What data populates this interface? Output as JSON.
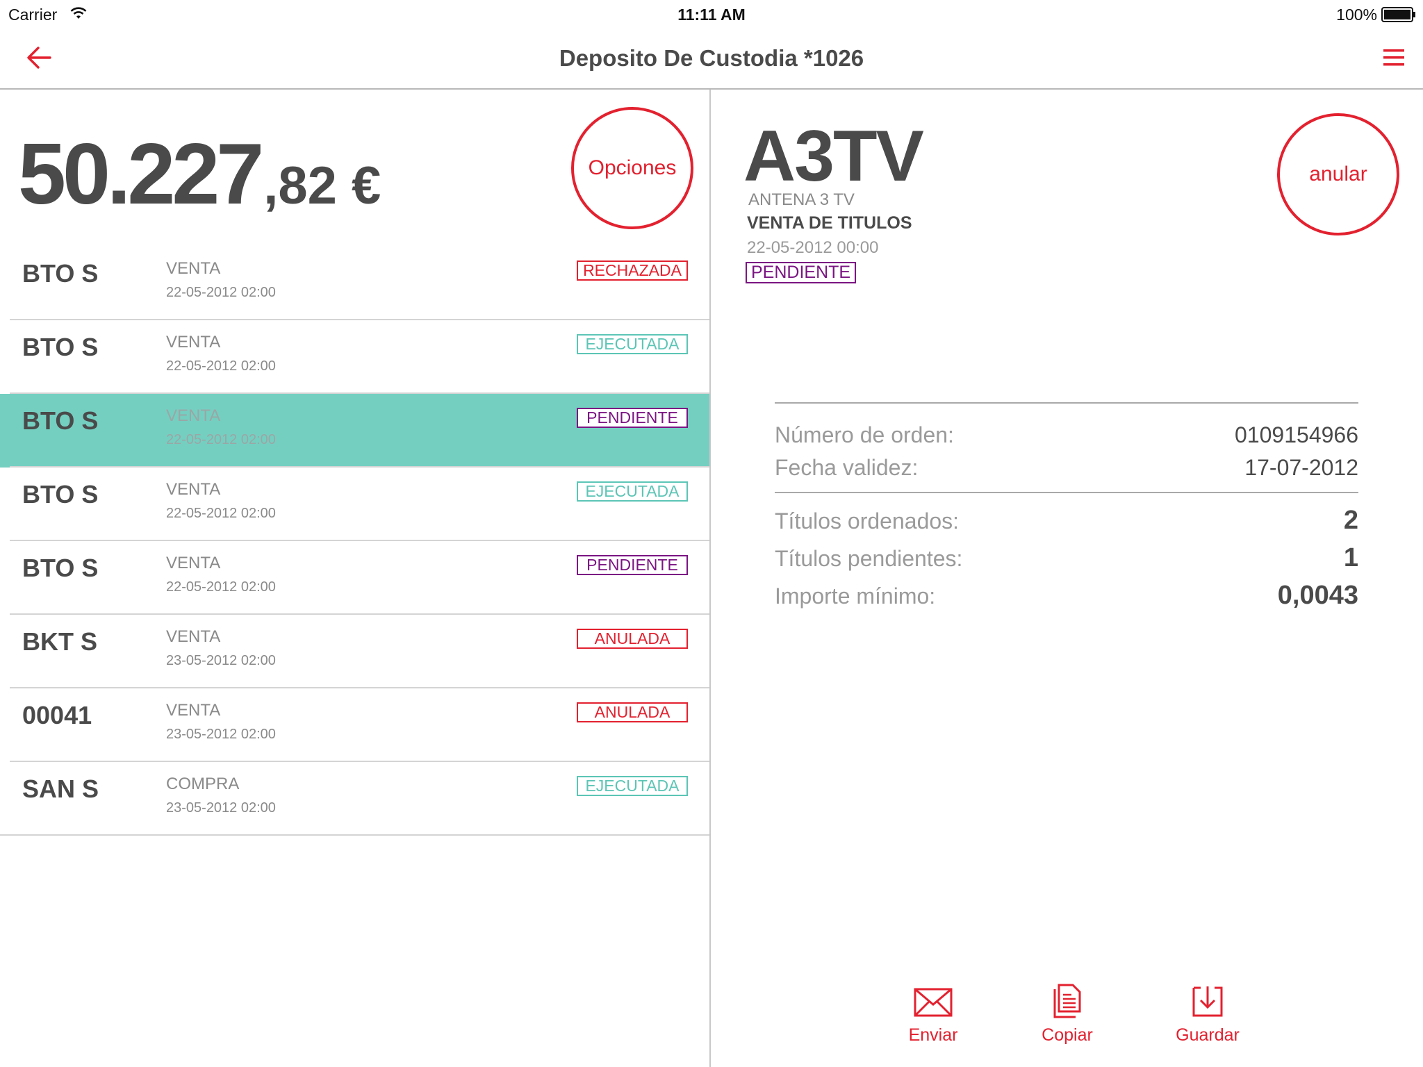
{
  "status_bar": {
    "carrier": "Carrier",
    "time": "11:11 AM",
    "battery": "100%"
  },
  "navbar": {
    "title": "Deposito De Custodia *1026",
    "back_icon": "arrow-left-icon",
    "menu_icon": "hamburger-menu-icon",
    "accent_color": "#e3212f"
  },
  "balance": {
    "integer_part": "50.227",
    "decimal_part": ",82 €"
  },
  "options_button": {
    "label": "Opciones"
  },
  "orders": [
    {
      "symbol": "BTO S",
      "operation": "VENTA",
      "date": "22-05-2012 02:00",
      "status": "RECHAZADA",
      "status_color": "#e3212f"
    },
    {
      "symbol": "BTO S",
      "operation": "VENTA",
      "date": "22-05-2012 02:00",
      "status": "EJECUTADA",
      "status_color": "#5cc5b6"
    },
    {
      "symbol": "BTO S",
      "operation": "VENTA",
      "date": "22-05-2012 02:00",
      "status": "PENDIENTE",
      "status_color": "#7b1583",
      "selected": true
    },
    {
      "symbol": "BTO S",
      "operation": "VENTA",
      "date": "22-05-2012 02:00",
      "status": "EJECUTADA",
      "status_color": "#5cc5b6"
    },
    {
      "symbol": "BTO S",
      "operation": "VENTA",
      "date": "22-05-2012 02:00",
      "status": "PENDIENTE",
      "status_color": "#7b1583"
    },
    {
      "symbol": "BKT S",
      "operation": "VENTA",
      "date": "23-05-2012 02:00",
      "status": "ANULADA",
      "status_color": "#e3212f"
    },
    {
      "symbol": "00041",
      "operation": "VENTA",
      "date": "23-05-2012 02:00",
      "status": "ANULADA",
      "status_color": "#e3212f"
    },
    {
      "symbol": "SAN S",
      "operation": "COMPRA",
      "date": "23-05-2012 02:00",
      "status": "EJECUTADA",
      "status_color": "#5cc5b6"
    }
  ],
  "detail": {
    "ticker": "A3TV",
    "company": "ANTENA 3 TV",
    "operation_type": "VENTA DE TITULOS",
    "date": "22-05-2012 00:00",
    "status": "PENDIENTE",
    "cancel_button": "anular",
    "fields": {
      "order_number_label": "Número de orden:",
      "order_number_value": "0109154966",
      "validity_label": "Fecha validez:",
      "validity_value": "17-07-2012",
      "ordered_label": "Títulos ordenados:",
      "ordered_value": "2",
      "pending_label": "Títulos pendientes:",
      "pending_value": "1",
      "min_amount_label": "Importe mínimo:",
      "min_amount_value": "0,0043"
    }
  },
  "actions": [
    {
      "label": "Enviar",
      "icon": "envelope-icon"
    },
    {
      "label": "Copiar",
      "icon": "document-copy-icon"
    },
    {
      "label": "Guardar",
      "icon": "download-save-icon"
    }
  ]
}
